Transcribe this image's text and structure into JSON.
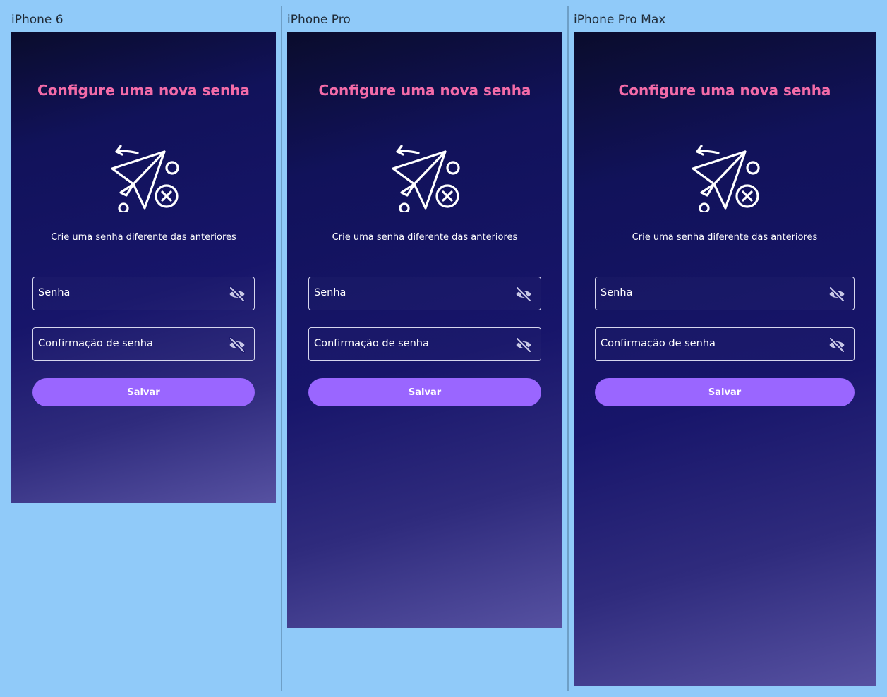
{
  "devices": [
    {
      "name": "iPhone 6"
    },
    {
      "name": "iPhone Pro"
    },
    {
      "name": "iPhone Pro Max"
    }
  ],
  "screen": {
    "title": "Configure uma nova senha",
    "subtitle": "Crie uma senha diferente das anteriores",
    "password_label": "Senha",
    "confirm_label": "Confirmação de senha",
    "save_label": "Salvar",
    "illustration_icon": "paper-plane-cancel-icon",
    "visibility_icon": "eye-off-icon"
  },
  "colors": {
    "board_background": "#90caf9",
    "title": "#f36ba8",
    "button": "#9a66ff",
    "gradient_top": "#0a0c2c",
    "gradient_bottom": "#5651a1"
  }
}
